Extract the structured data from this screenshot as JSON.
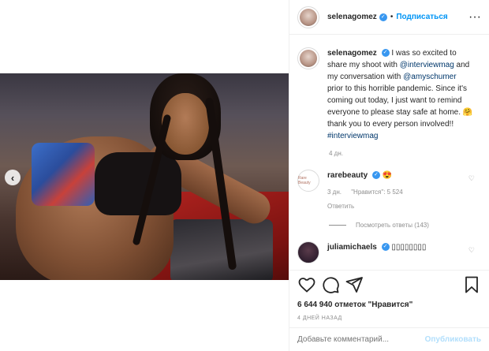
{
  "post": {
    "username": "selenagomez",
    "verified_icon": "verified-badge-icon",
    "follow_label": "Подписаться",
    "separator": "•",
    "caption_parts": [
      "I was so excited to share my shoot with ",
      "@interviewmag",
      " and my conversation with ",
      "@amyschumer",
      " prior to this horrible pandemic. Since it's coming out today, I just want to remind everyone to please stay safe at home. ",
      "🤗",
      " thank you to every person involved!! ",
      "#interviewmag"
    ],
    "age": "4 дн."
  },
  "comments": [
    {
      "username": "rarebeauty",
      "avatar_text": "Rare Beauty",
      "text": "😍",
      "meta_time": "3 дн.",
      "meta_likes": "\"Нравится\": 5 524",
      "meta_reply": "Ответить",
      "view_replies": "Посмотреть ответы (143)"
    },
    {
      "username": "juliamichaels",
      "text": "▯▯▯▯▯▯▯▯"
    }
  ],
  "actions": {
    "likes": "6 644 940 отметок \"Нравится\"",
    "date": "4 ДНЕЙ НАЗАД",
    "comment_placeholder": "Добавьте комментарий...",
    "publish_label": "Опубликовать"
  },
  "colors": {
    "accent": "#0095f6",
    "verified": "#3897f0",
    "mention": "#00376b",
    "muted": "#8e8e8e",
    "publish_disabled": "#b2dffc"
  }
}
